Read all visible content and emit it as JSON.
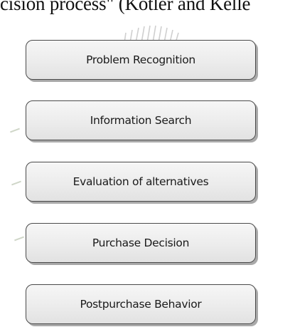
{
  "header": {
    "text": "cision process\" (Kotler and Kelle"
  },
  "steps": [
    {
      "label": "Problem Recognition"
    },
    {
      "label": "Information Search"
    },
    {
      "label": "Evaluation of alternatives"
    },
    {
      "label": "Purchase Decision"
    },
    {
      "label": "Postpurchase Behavior"
    }
  ]
}
